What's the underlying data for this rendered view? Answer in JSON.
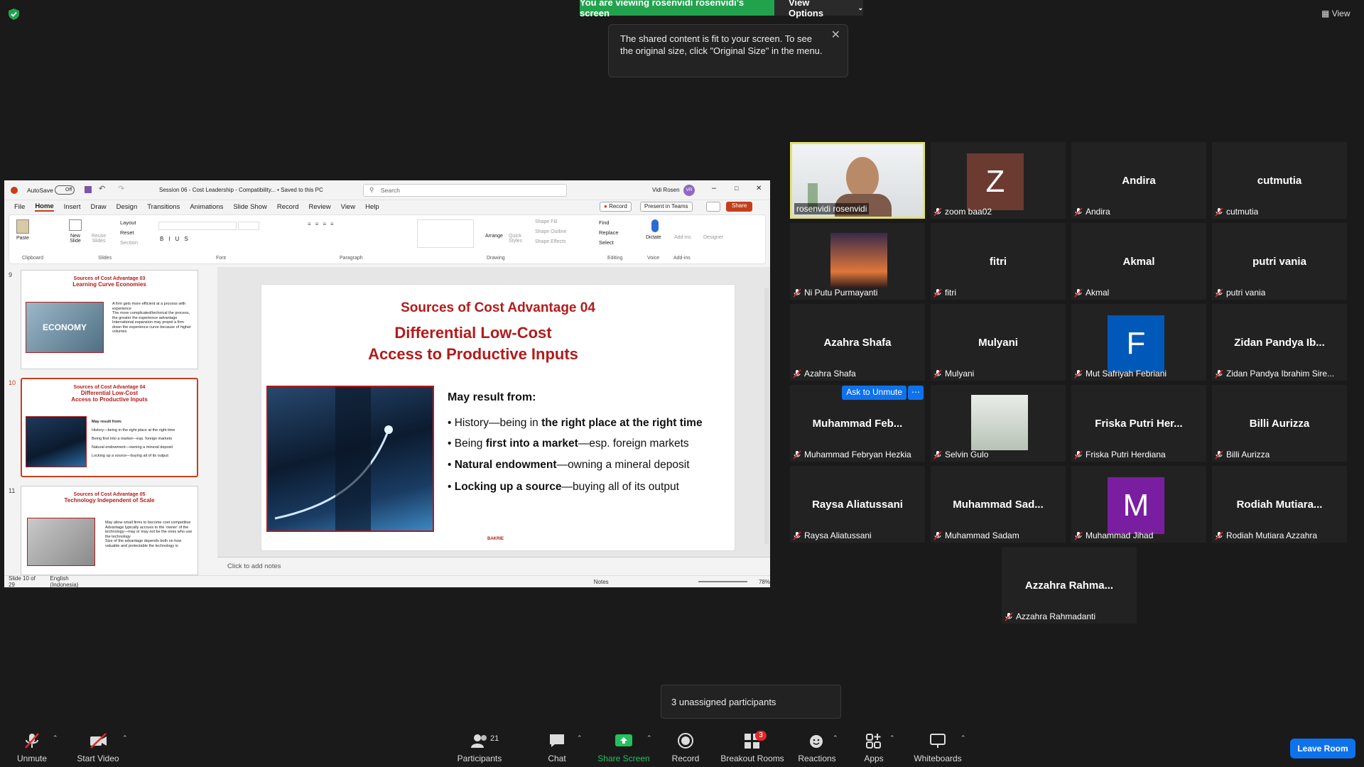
{
  "top": {
    "banner": "You are viewing rosenvidi rosenvidi's screen",
    "view_options": "View Options",
    "tooltip": "The shared content is fit to your screen. To see the original size, click \"Original Size\" in the menu.",
    "view": "View"
  },
  "ppt": {
    "autosave": "AutoSave",
    "autosave_state": "Off",
    "doc_title": "Session 06 - Cost Leadership - Compatibility... • Saved to this PC",
    "search_placeholder": "Search",
    "user": "Vidi Rosen",
    "user_initials": "VR",
    "menu": [
      "File",
      "Home",
      "Insert",
      "Draw",
      "Design",
      "Transitions",
      "Animations",
      "Slide Show",
      "Record",
      "Review",
      "View",
      "Help"
    ],
    "record_btn": "Record",
    "present_btn": "Present in Teams",
    "share_btn": "Share",
    "ribbon_groups": [
      "Clipboard",
      "Slides",
      "Font",
      "Paragraph",
      "Drawing",
      "Editing",
      "Voice",
      "Add-ins"
    ],
    "ribbon_items": {
      "paste": "Paste",
      "new_slide": "New Slide",
      "reuse": "Reuse Slides",
      "layout": "Layout",
      "reset": "Reset",
      "section": "Section",
      "arrange": "Arrange",
      "quick_styles": "Quick Styles",
      "shape_fill": "Shape Fill",
      "shape_outline": "Shape Outline",
      "shape_effects": "Shape Effects",
      "find": "Find",
      "replace": "Replace",
      "select": "Select",
      "dictate": "Dictate",
      "addins": "Add-ins",
      "designer": "Designer"
    },
    "thumbs": [
      {
        "num": "9",
        "t1": "Sources of Cost Advantage 03",
        "t2": "Learning Curve Economies",
        "bullets": [
          "A firm gets more efficient at a process with experience",
          "The more complicated/technical the process, the greater the experience advantage",
          "International expansion may propel a firm down the experience curve because of higher volumes"
        ],
        "img": "ECONOMY"
      },
      {
        "num": "10",
        "t1": "Sources of Cost Advantage 04",
        "t2": "Differential Low-Cost",
        "t3": "Access to Productive Inputs",
        "head": "May result from:",
        "bullets": [
          "History—being in the right place at the right time",
          "Being first into a market—esp. foreign markets",
          "Natural endowment—owning a mineral deposit",
          "Locking up a source—buying all of its output"
        ]
      },
      {
        "num": "11",
        "t1": "Sources of Cost Advantage 05",
        "t2": "Technology Independent of Scale",
        "bullets": [
          "May allow small firms to become cost competitive",
          "Advantage typically accrues to the 'owner' of the technology—may or may not be the ones who use the technology",
          "Size of the advantage depends both on how valuable and protectable the technology is"
        ]
      }
    ],
    "slide": {
      "title1": "Sources of Cost Advantage 04",
      "title2": "Differential Low-Cost",
      "title3": "Access to Productive Inputs",
      "head": "May result from:",
      "b1_a": "History—being in ",
      "b1_b": "the right place at the right time",
      "b2_a": "Being ",
      "b2_b": "first into a market",
      "b2_c": "—esp. foreign markets",
      "b3_a": "Natural endowment",
      "b3_b": "—owning a mineral deposit",
      "b4_a": "Locking up a source",
      "b4_b": "—buying all of its output",
      "logo": "BAKRIE"
    },
    "notes": "Click to add notes",
    "status_slide": "Slide 10 of 29",
    "status_lang": "English (Indonesia)",
    "status_notes": "Notes",
    "zoom": "78%"
  },
  "participants": [
    {
      "name": "",
      "label": "rosenvidi rosenvidi",
      "video": true,
      "muted": false,
      "active": true
    },
    {
      "name": "",
      "label": "zoom baa02",
      "avatar": "Z",
      "color": "#6b3a31"
    },
    {
      "name": "Andira",
      "label": "Andira"
    },
    {
      "name": "cutmutia",
      "label": "cutmutia"
    },
    {
      "name": "",
      "label": "Ni Putu Purmayanti",
      "photo": "sunset"
    },
    {
      "name": "fitri",
      "label": "fitri"
    },
    {
      "name": "Akmal",
      "label": "Akmal"
    },
    {
      "name": "putri vania",
      "label": "putri vania"
    },
    {
      "name": "Azahra Shafa",
      "label": "Azahra Shafa"
    },
    {
      "name": "Mulyani",
      "label": "Mulyani"
    },
    {
      "name": "",
      "label": "Mut Safriyah Febriani",
      "avatar": "F",
      "color": "#0059b8"
    },
    {
      "name": "Zidan  Pandya  Ib...",
      "label": "Zidan Pandya Ibrahim Sire..."
    },
    {
      "name": "Muhammad  Feb...",
      "label": "Muhammad Febryan Hezkia",
      "ask": "Ask to Unmute"
    },
    {
      "name": "",
      "label": "Selvin Gulo",
      "photo": "classroom"
    },
    {
      "name": "Friska  Putri  Her...",
      "label": "Friska Putri Herdiana"
    },
    {
      "name": "Billi Aurizza",
      "label": "Billi Aurizza"
    },
    {
      "name": "Raysa Aliatussani",
      "label": "Raysa Aliatussani"
    },
    {
      "name": "Muhammad  Sad...",
      "label": "Muhammad Sadam"
    },
    {
      "name": "",
      "label": "Muhammad Jihad",
      "avatar": "M",
      "color": "#7a1ea1"
    },
    {
      "name": "Rodiah  Mutiara...",
      "label": "Rodiah Mutiara Azzahra"
    },
    {
      "name": "Azzahra  Rahma...",
      "label": "Azzahra Rahmadanti"
    }
  ],
  "toolbar": {
    "unmute": "Unmute",
    "start_video": "Start Video",
    "participants": "Participants",
    "participants_count": "21",
    "chat": "Chat",
    "share": "Share Screen",
    "record": "Record",
    "breakout": "Breakout Rooms",
    "breakout_badge": "3",
    "reactions": "Reactions",
    "apps": "Apps",
    "whiteboards": "Whiteboards",
    "leave": "Leave Room",
    "unassigned": "3 unassigned participants"
  },
  "colors": {
    "accent": "#0e72ed",
    "share_green": "#23a24d",
    "ppt_red": "#c43e1c",
    "slide_red": "#b31b1b",
    "active_border": "#e2e36b"
  }
}
